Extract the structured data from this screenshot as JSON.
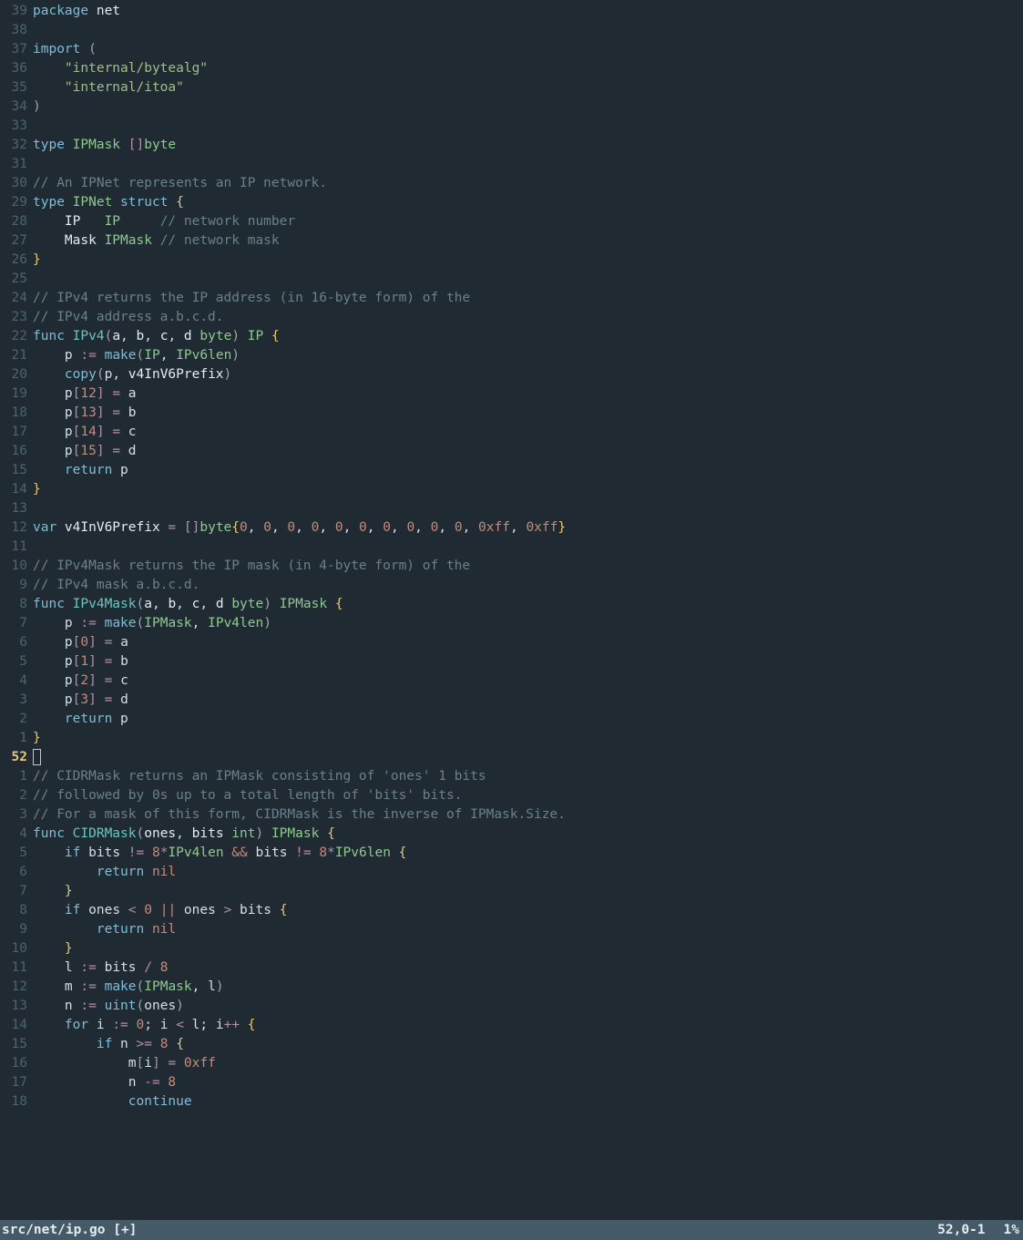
{
  "statusline": {
    "filename": "src/net/ip.go [+]",
    "position": "52,0-1",
    "percent": "1%"
  },
  "cursor_abs_line": "52",
  "lines": [
    {
      "rel": "39",
      "tokens": [
        [
          "package ",
          "c-kw"
        ],
        [
          "net",
          "c-ident"
        ]
      ]
    },
    {
      "rel": "38",
      "tokens": []
    },
    {
      "rel": "37",
      "tokens": [
        [
          "import ",
          "c-kw"
        ],
        [
          "(",
          "c-paren"
        ]
      ]
    },
    {
      "rel": "36",
      "tokens": [
        [
          "    ",
          ""
        ],
        [
          "\"internal/bytealg\"",
          "c-string"
        ]
      ]
    },
    {
      "rel": "35",
      "tokens": [
        [
          "    ",
          ""
        ],
        [
          "\"internal/itoa\"",
          "c-string"
        ]
      ]
    },
    {
      "rel": "34",
      "tokens": [
        [
          ")",
          "c-paren"
        ]
      ]
    },
    {
      "rel": "33",
      "tokens": []
    },
    {
      "rel": "32",
      "tokens": [
        [
          "type ",
          "c-kw"
        ],
        [
          "IPMask ",
          "c-type"
        ],
        [
          "[]",
          "c-op"
        ],
        [
          "byte",
          "c-type"
        ]
      ]
    },
    {
      "rel": "31",
      "tokens": []
    },
    {
      "rel": "30",
      "tokens": [
        [
          "// An IPNet represents an IP network.",
          "c-comment"
        ]
      ]
    },
    {
      "rel": "29",
      "tokens": [
        [
          "type ",
          "c-kw"
        ],
        [
          "IPNet ",
          "c-type"
        ],
        [
          "struct ",
          "c-kw"
        ],
        [
          "{",
          "c-brace"
        ]
      ]
    },
    {
      "rel": "28",
      "tokens": [
        [
          "    IP   ",
          "c-ident"
        ],
        [
          "IP     ",
          "c-type"
        ],
        [
          "// network number",
          "c-comment"
        ]
      ]
    },
    {
      "rel": "27",
      "tokens": [
        [
          "    Mask ",
          "c-ident"
        ],
        [
          "IPMask ",
          "c-type"
        ],
        [
          "// network mask",
          "c-comment"
        ]
      ]
    },
    {
      "rel": "26",
      "tokens": [
        [
          "}",
          "c-brace"
        ]
      ]
    },
    {
      "rel": "25",
      "tokens": []
    },
    {
      "rel": "24",
      "tokens": [
        [
          "// IPv4 returns the IP address (in 16-byte form) of the",
          "c-comment"
        ]
      ]
    },
    {
      "rel": "23",
      "tokens": [
        [
          "// IPv4 address a.b.c.d.",
          "c-comment"
        ]
      ]
    },
    {
      "rel": "22",
      "tokens": [
        [
          "func ",
          "c-kw"
        ],
        [
          "IPv4",
          "c-func"
        ],
        [
          "(",
          "c-paren"
        ],
        [
          "a",
          "c-ident"
        ],
        [
          ", ",
          ""
        ],
        [
          "b",
          "c-ident"
        ],
        [
          ", ",
          ""
        ],
        [
          "c",
          "c-ident"
        ],
        [
          ", ",
          ""
        ],
        [
          "d ",
          "c-ident"
        ],
        [
          "byte",
          "c-type"
        ],
        [
          ") ",
          "c-paren"
        ],
        [
          "IP ",
          "c-type"
        ],
        [
          "{",
          "c-brace"
        ]
      ]
    },
    {
      "rel": "21",
      "tokens": [
        [
          "    p ",
          ""
        ],
        [
          ":= ",
          "c-op"
        ],
        [
          "make",
          "c-builtin"
        ],
        [
          "(",
          "c-paren"
        ],
        [
          "IP",
          "c-type"
        ],
        [
          ", ",
          ""
        ],
        [
          "IPv6len",
          "c-const"
        ],
        [
          ")",
          "c-paren"
        ]
      ]
    },
    {
      "rel": "20",
      "tokens": [
        [
          "    ",
          ""
        ],
        [
          "copy",
          "c-builtin"
        ],
        [
          "(",
          "c-paren"
        ],
        [
          "p",
          ""
        ],
        [
          ", ",
          ""
        ],
        [
          "v4InV6Prefix",
          "c-ident"
        ],
        [
          ")",
          "c-paren"
        ]
      ]
    },
    {
      "rel": "19",
      "tokens": [
        [
          "    p",
          ""
        ],
        [
          "[",
          "c-op"
        ],
        [
          "12",
          "c-num"
        ],
        [
          "] ",
          "c-op"
        ],
        [
          "= ",
          "c-op"
        ],
        [
          "a",
          ""
        ]
      ]
    },
    {
      "rel": "18",
      "tokens": [
        [
          "    p",
          ""
        ],
        [
          "[",
          "c-op"
        ],
        [
          "13",
          "c-num"
        ],
        [
          "] ",
          "c-op"
        ],
        [
          "= ",
          "c-op"
        ],
        [
          "b",
          ""
        ]
      ]
    },
    {
      "rel": "17",
      "tokens": [
        [
          "    p",
          ""
        ],
        [
          "[",
          "c-op"
        ],
        [
          "14",
          "c-num"
        ],
        [
          "] ",
          "c-op"
        ],
        [
          "= ",
          "c-op"
        ],
        [
          "c",
          ""
        ]
      ]
    },
    {
      "rel": "16",
      "tokens": [
        [
          "    p",
          ""
        ],
        [
          "[",
          "c-op"
        ],
        [
          "15",
          "c-num"
        ],
        [
          "] ",
          "c-op"
        ],
        [
          "= ",
          "c-op"
        ],
        [
          "d",
          ""
        ]
      ]
    },
    {
      "rel": "15",
      "tokens": [
        [
          "    ",
          ""
        ],
        [
          "return ",
          "c-kw"
        ],
        [
          "p",
          ""
        ]
      ]
    },
    {
      "rel": "14",
      "tokens": [
        [
          "}",
          "c-brace"
        ]
      ]
    },
    {
      "rel": "13",
      "tokens": []
    },
    {
      "rel": "12",
      "tokens": [
        [
          "var ",
          "c-kw"
        ],
        [
          "v4InV6Prefix ",
          "c-ident"
        ],
        [
          "= ",
          "c-op"
        ],
        [
          "[]",
          "c-op"
        ],
        [
          "byte",
          "c-type"
        ],
        [
          "{",
          "c-brace"
        ],
        [
          "0",
          "c-num"
        ],
        [
          ", ",
          ""
        ],
        [
          "0",
          "c-num"
        ],
        [
          ", ",
          ""
        ],
        [
          "0",
          "c-num"
        ],
        [
          ", ",
          ""
        ],
        [
          "0",
          "c-num"
        ],
        [
          ", ",
          ""
        ],
        [
          "0",
          "c-num"
        ],
        [
          ", ",
          ""
        ],
        [
          "0",
          "c-num"
        ],
        [
          ", ",
          ""
        ],
        [
          "0",
          "c-num"
        ],
        [
          ", ",
          ""
        ],
        [
          "0",
          "c-num"
        ],
        [
          ", ",
          ""
        ],
        [
          "0",
          "c-num"
        ],
        [
          ", ",
          ""
        ],
        [
          "0",
          "c-num"
        ],
        [
          ", ",
          ""
        ],
        [
          "0xff",
          "c-num"
        ],
        [
          ", ",
          ""
        ],
        [
          "0xff",
          "c-num"
        ],
        [
          "}",
          "c-brace"
        ]
      ]
    },
    {
      "rel": "11",
      "tokens": []
    },
    {
      "rel": "10",
      "tokens": [
        [
          "// IPv4Mask returns the IP mask (in 4-byte form) of the",
          "c-comment"
        ]
      ]
    },
    {
      "rel": "9",
      "tokens": [
        [
          "// IPv4 mask a.b.c.d.",
          "c-comment"
        ]
      ]
    },
    {
      "rel": "8",
      "tokens": [
        [
          "func ",
          "c-kw"
        ],
        [
          "IPv4Mask",
          "c-func"
        ],
        [
          "(",
          "c-paren"
        ],
        [
          "a",
          "c-ident"
        ],
        [
          ", ",
          ""
        ],
        [
          "b",
          "c-ident"
        ],
        [
          ", ",
          ""
        ],
        [
          "c",
          "c-ident"
        ],
        [
          ", ",
          ""
        ],
        [
          "d ",
          "c-ident"
        ],
        [
          "byte",
          "c-type"
        ],
        [
          ") ",
          "c-paren"
        ],
        [
          "IPMask ",
          "c-type"
        ],
        [
          "{",
          "c-brace"
        ]
      ]
    },
    {
      "rel": "7",
      "tokens": [
        [
          "    p ",
          ""
        ],
        [
          ":= ",
          "c-op"
        ],
        [
          "make",
          "c-builtin"
        ],
        [
          "(",
          "c-paren"
        ],
        [
          "IPMask",
          "c-type"
        ],
        [
          ", ",
          ""
        ],
        [
          "IPv4len",
          "c-const"
        ],
        [
          ")",
          "c-paren"
        ]
      ]
    },
    {
      "rel": "6",
      "tokens": [
        [
          "    p",
          ""
        ],
        [
          "[",
          "c-op"
        ],
        [
          "0",
          "c-num"
        ],
        [
          "] ",
          "c-op"
        ],
        [
          "= ",
          "c-op"
        ],
        [
          "a",
          ""
        ]
      ]
    },
    {
      "rel": "5",
      "tokens": [
        [
          "    p",
          ""
        ],
        [
          "[",
          "c-op"
        ],
        [
          "1",
          "c-num"
        ],
        [
          "] ",
          "c-op"
        ],
        [
          "= ",
          "c-op"
        ],
        [
          "b",
          ""
        ]
      ]
    },
    {
      "rel": "4",
      "tokens": [
        [
          "    p",
          ""
        ],
        [
          "[",
          "c-op"
        ],
        [
          "2",
          "c-num"
        ],
        [
          "] ",
          "c-op"
        ],
        [
          "= ",
          "c-op"
        ],
        [
          "c",
          ""
        ]
      ]
    },
    {
      "rel": "3",
      "tokens": [
        [
          "    p",
          ""
        ],
        [
          "[",
          "c-op"
        ],
        [
          "3",
          "c-num"
        ],
        [
          "] ",
          "c-op"
        ],
        [
          "= ",
          "c-op"
        ],
        [
          "d",
          ""
        ]
      ]
    },
    {
      "rel": "2",
      "tokens": [
        [
          "    ",
          ""
        ],
        [
          "return ",
          "c-kw"
        ],
        [
          "p",
          ""
        ]
      ]
    },
    {
      "rel": "1",
      "tokens": [
        [
          "}",
          "c-brace"
        ]
      ]
    },
    {
      "rel": "CURSOR",
      "tokens": []
    },
    {
      "rel": "1",
      "tokens": [
        [
          "// CIDRMask returns an IPMask consisting of 'ones' 1 bits",
          "c-comment"
        ]
      ]
    },
    {
      "rel": "2",
      "tokens": [
        [
          "// followed by 0s up to a total length of 'bits' bits.",
          "c-comment"
        ]
      ]
    },
    {
      "rel": "3",
      "tokens": [
        [
          "// For a mask of this form, CIDRMask is the inverse of IPMask.Size.",
          "c-comment"
        ]
      ]
    },
    {
      "rel": "4",
      "tokens": [
        [
          "func ",
          "c-kw"
        ],
        [
          "CIDRMask",
          "c-func"
        ],
        [
          "(",
          "c-paren"
        ],
        [
          "ones",
          "c-ident"
        ],
        [
          ", ",
          ""
        ],
        [
          "bits ",
          "c-ident"
        ],
        [
          "int",
          "c-type"
        ],
        [
          ") ",
          "c-paren"
        ],
        [
          "IPMask ",
          "c-type"
        ],
        [
          "{",
          "c-brace"
        ]
      ]
    },
    {
      "rel": "5",
      "tokens": [
        [
          "    ",
          ""
        ],
        [
          "if ",
          "c-kw"
        ],
        [
          "bits ",
          ""
        ],
        [
          "!= ",
          "c-op"
        ],
        [
          "8",
          "c-num"
        ],
        [
          "*",
          "c-op"
        ],
        [
          "IPv4len ",
          "c-const"
        ],
        [
          "&& ",
          "c-bool"
        ],
        [
          "bits ",
          ""
        ],
        [
          "!= ",
          "c-op"
        ],
        [
          "8",
          "c-num"
        ],
        [
          "*",
          "c-op"
        ],
        [
          "IPv6len ",
          "c-const"
        ],
        [
          "{",
          "c-brace"
        ]
      ]
    },
    {
      "rel": "6",
      "tokens": [
        [
          "        ",
          ""
        ],
        [
          "return ",
          "c-kw"
        ],
        [
          "nil",
          "c-num"
        ]
      ]
    },
    {
      "rel": "7",
      "tokens": [
        [
          "    ",
          ""
        ],
        [
          "}",
          "c-brace"
        ]
      ]
    },
    {
      "rel": "8",
      "tokens": [
        [
          "    ",
          ""
        ],
        [
          "if ",
          "c-kw"
        ],
        [
          "ones ",
          ""
        ],
        [
          "< ",
          "c-op"
        ],
        [
          "0 ",
          "c-num"
        ],
        [
          "|| ",
          "c-bool"
        ],
        [
          "ones ",
          ""
        ],
        [
          "> ",
          "c-op"
        ],
        [
          "bits ",
          ""
        ],
        [
          "{",
          "c-brace"
        ]
      ]
    },
    {
      "rel": "9",
      "tokens": [
        [
          "        ",
          ""
        ],
        [
          "return ",
          "c-kw"
        ],
        [
          "nil",
          "c-num"
        ]
      ]
    },
    {
      "rel": "10",
      "tokens": [
        [
          "    ",
          ""
        ],
        [
          "}",
          "c-brace"
        ]
      ]
    },
    {
      "rel": "11",
      "tokens": [
        [
          "    l ",
          ""
        ],
        [
          ":= ",
          "c-op"
        ],
        [
          "bits ",
          ""
        ],
        [
          "/ ",
          "c-op"
        ],
        [
          "8",
          "c-num"
        ]
      ]
    },
    {
      "rel": "12",
      "tokens": [
        [
          "    m ",
          ""
        ],
        [
          ":= ",
          "c-op"
        ],
        [
          "make",
          "c-builtin"
        ],
        [
          "(",
          "c-paren"
        ],
        [
          "IPMask",
          "c-type"
        ],
        [
          ", ",
          ""
        ],
        [
          "l",
          ""
        ],
        [
          ")",
          "c-paren"
        ]
      ]
    },
    {
      "rel": "13",
      "tokens": [
        [
          "    n ",
          ""
        ],
        [
          ":= ",
          "c-op"
        ],
        [
          "uint",
          "c-builtin"
        ],
        [
          "(",
          "c-paren"
        ],
        [
          "ones",
          ""
        ],
        [
          ")",
          "c-paren"
        ]
      ]
    },
    {
      "rel": "14",
      "tokens": [
        [
          "    ",
          ""
        ],
        [
          "for ",
          "c-kw"
        ],
        [
          "i ",
          ""
        ],
        [
          ":= ",
          "c-op"
        ],
        [
          "0",
          "c-num"
        ],
        [
          "; ",
          ""
        ],
        [
          "i ",
          ""
        ],
        [
          "< ",
          "c-op"
        ],
        [
          "l",
          ""
        ],
        [
          "; ",
          ""
        ],
        [
          "i",
          ""
        ],
        [
          "++ ",
          "c-op"
        ],
        [
          "{",
          "c-brace"
        ]
      ]
    },
    {
      "rel": "15",
      "tokens": [
        [
          "        ",
          ""
        ],
        [
          "if ",
          "c-kw"
        ],
        [
          "n ",
          ""
        ],
        [
          ">= ",
          "c-op"
        ],
        [
          "8 ",
          "c-num"
        ],
        [
          "{",
          "c-brace"
        ]
      ]
    },
    {
      "rel": "16",
      "tokens": [
        [
          "            m",
          ""
        ],
        [
          "[",
          "c-op"
        ],
        [
          "i",
          ""
        ],
        [
          "] ",
          "c-op"
        ],
        [
          "= ",
          "c-op"
        ],
        [
          "0xff",
          "c-num"
        ]
      ]
    },
    {
      "rel": "17",
      "tokens": [
        [
          "            n ",
          ""
        ],
        [
          "-= ",
          "c-op"
        ],
        [
          "8",
          "c-num"
        ]
      ]
    },
    {
      "rel": "18",
      "tokens": [
        [
          "            ",
          ""
        ],
        [
          "continue",
          "c-kw"
        ]
      ]
    }
  ]
}
